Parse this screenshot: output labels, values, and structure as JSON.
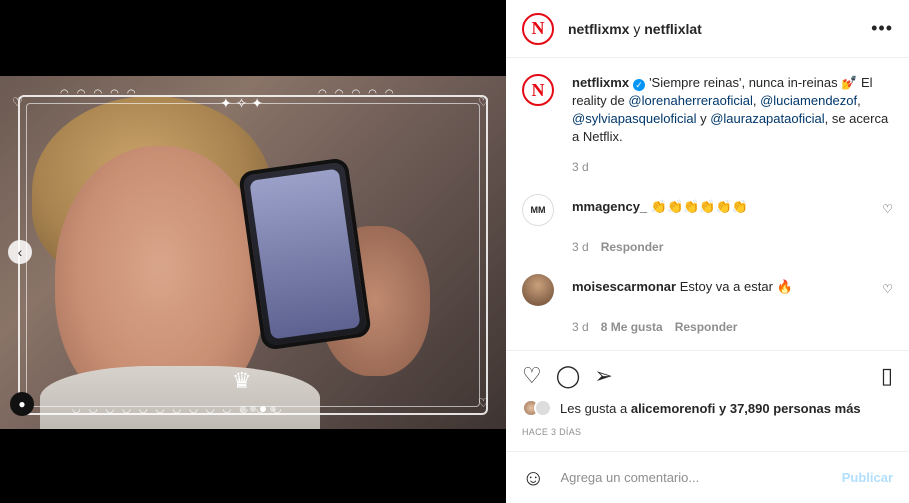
{
  "post_header": {
    "account": "netflixmx",
    "connector": "y",
    "collaborator": "netflixlat",
    "avatar_letter": "N"
  },
  "caption": {
    "username": "netflixmx",
    "text_1": "'Siempre reinas', nunca in-reinas",
    "emoji_1": "💅",
    "text_2": " El reality de ",
    "m1": "@lorenaherreraoficial",
    "sep1": ", ",
    "m2": "@luciamendezof",
    "sep2": ", ",
    "m3": "@sylviapasqueloficial",
    "sep3": " y ",
    "m4": "@laurazapataoficial",
    "text_3": ", se acerca a Netflix.",
    "time": "3 d"
  },
  "comments": [
    {
      "user": "mmagency_",
      "text": "👏👏👏👏👏👏",
      "time": "3 d",
      "likes": "",
      "reply": "Responder",
      "avatar_text": "MM"
    },
    {
      "user": "moisescarmonar",
      "text": "Estoy va a estar 🔥",
      "time": "3 d",
      "likes": "8 Me gusta",
      "reply": "Responder",
      "avatar_text": ""
    }
  ],
  "likes": {
    "prefix": "Les gusta a",
    "user": "alicemorenofi",
    "suffix": "y 37,890 personas más"
  },
  "timestamp": "HACE 3 DÍAS",
  "composer": {
    "placeholder": "Agrega un comentario...",
    "publish": "Publicar"
  },
  "icons": {
    "more": "more-icon",
    "like": "heart-icon",
    "comment": "comment-icon",
    "share": "share-icon",
    "save": "bookmark-icon"
  },
  "colors": {
    "brand_red": "#e50914",
    "link": "#00376b",
    "verified": "#0095f6",
    "publish_disabled": "#b2dffc"
  }
}
